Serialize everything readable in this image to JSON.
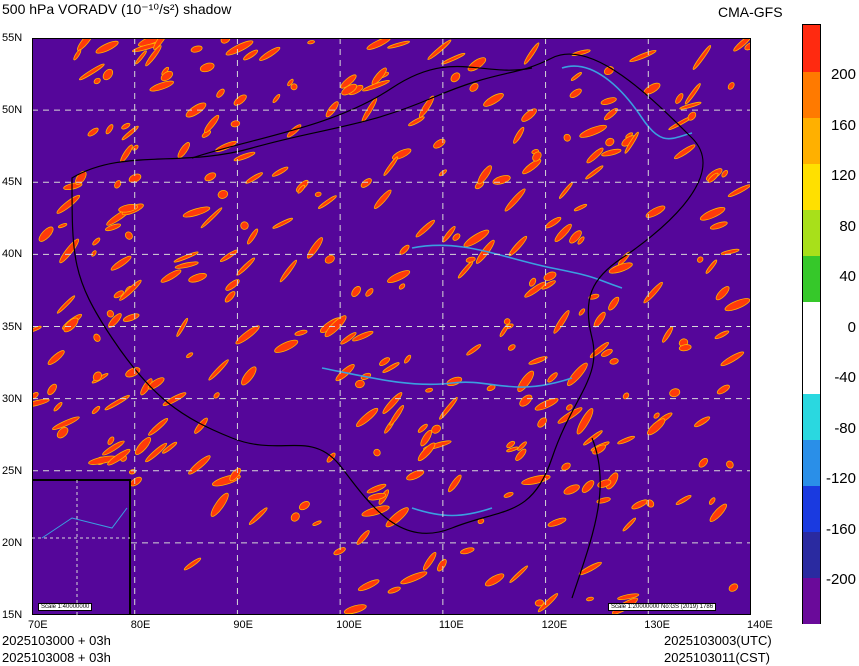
{
  "header": {
    "title_left": "500 hPa VORADV (10⁻¹⁰/s²) shadow",
    "title_right": "CMA-GFS"
  },
  "map": {
    "lat_labels": [
      "55N",
      "50N",
      "45N",
      "40N",
      "35N",
      "30N",
      "25N",
      "20N",
      "15N"
    ],
    "lon_labels": [
      "70E",
      "80E",
      "90E",
      "100E",
      "110E",
      "120E",
      "130E",
      "140E"
    ],
    "scale_main": "Scale 1:20000000 No:GS (2019) 1786",
    "scale_inset": "Scale 1:40000000",
    "colors": {
      "background": "#55069a",
      "positive": "#ff3a0a",
      "contour": "#ffb400",
      "river": "#3b9fe0",
      "border": "#000000",
      "grid": "#d8d8d8"
    }
  },
  "colorbar": {
    "labels": [
      "200",
      "160",
      "120",
      "80",
      "40",
      "0",
      "-40",
      "-80",
      "-120",
      "-160",
      "-200"
    ],
    "colors": [
      "#6a0a9a",
      "#2a2aa0",
      "#1a3ae0",
      "#2a8fe8",
      "#2ad8e0",
      "#ffffff",
      "#ffffff",
      "#36c82a",
      "#a8e01a",
      "#ffe000",
      "#ffb000",
      "#ff7a00",
      "#ff2a10"
    ]
  },
  "footer": {
    "left_line1": "2025103000 + 03h",
    "left_line2": "2025103008 + 03h",
    "right_line1": "2025103003(UTC)",
    "right_line2": "2025103011(CST)"
  }
}
